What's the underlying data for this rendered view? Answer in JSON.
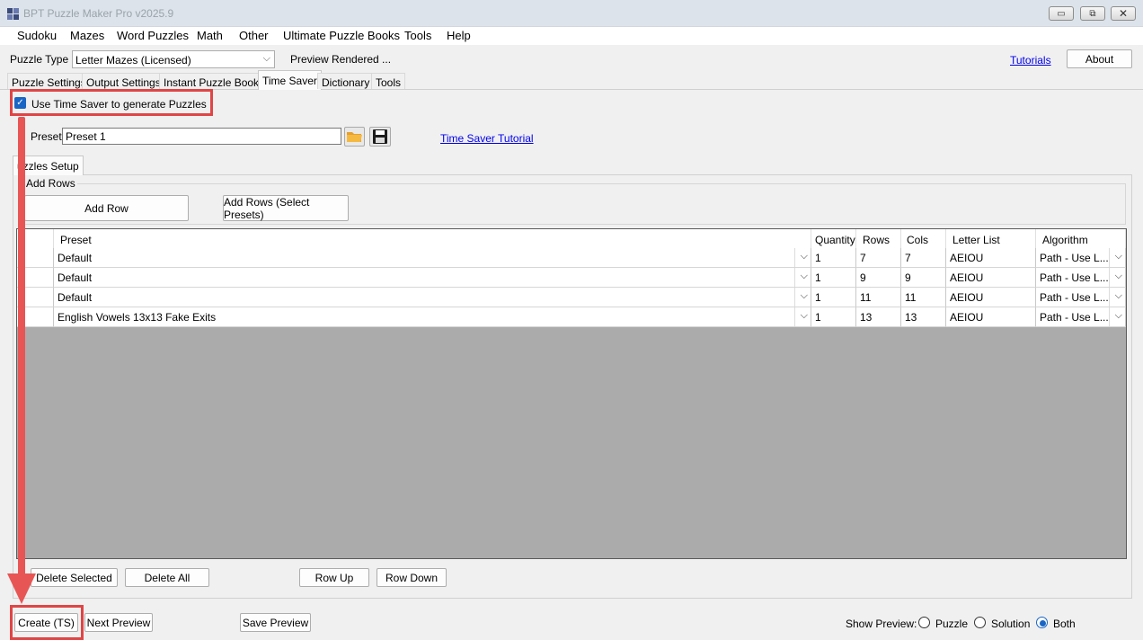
{
  "window": {
    "title": "BPT Puzzle Maker Pro v2025.9",
    "minimize_glyph": "▭",
    "maximize_glyph": "⧉",
    "close_glyph": "✕"
  },
  "menu": [
    "Sudoku",
    "Mazes",
    "Word Puzzles",
    "Math",
    "Other",
    "Ultimate Puzzle Books",
    "Tools",
    "Help"
  ],
  "header": {
    "puzzle_type_label": "Puzzle Type",
    "puzzle_type_value": "Letter Mazes (Licensed)",
    "preview_rendered": "Preview Rendered ...",
    "tutorials": "Tutorials",
    "about": "About"
  },
  "tabs": [
    "Puzzle Settings",
    "Output Settings",
    "Instant Puzzle Books",
    "Time Saver",
    "Dictionary",
    "Tools"
  ],
  "active_tab": "Time Saver",
  "time_saver": {
    "use_checkbox_label": "Use Time Saver to generate Puzzles",
    "use_checked": true,
    "preset_label": "Preset",
    "preset_value": "Preset 1",
    "tutorial_link": "Time Saver Tutorial",
    "setup_tab": "uzzles Setup",
    "add_rows_group": "Add Rows",
    "add_row_button": "Add Row",
    "add_rows_presets_button": "Add Rows (Select Presets)"
  },
  "grid": {
    "columns": [
      "Preset",
      "Quantity",
      "Rows",
      "Cols",
      "Letter List",
      "Algorithm"
    ],
    "rows": [
      {
        "preset": "Default",
        "quantity": "1",
        "rows": "7",
        "cols": "7",
        "letters": "AEIOU",
        "algorithm": "Path - Use L..."
      },
      {
        "preset": "Default",
        "quantity": "1",
        "rows": "9",
        "cols": "9",
        "letters": "AEIOU",
        "algorithm": "Path - Use L..."
      },
      {
        "preset": "Default",
        "quantity": "1",
        "rows": "11",
        "cols": "11",
        "letters": "AEIOU",
        "algorithm": "Path - Use L..."
      },
      {
        "preset": "English Vowels 13x13 Fake Exits",
        "quantity": "1",
        "rows": "13",
        "cols": "13",
        "letters": "AEIOU",
        "algorithm": "Path - Use L..."
      }
    ]
  },
  "buttons": {
    "delete_selected": "Delete Selected",
    "delete_all": "Delete All",
    "row_up": "Row Up",
    "row_down": "Row Down",
    "create_ts": "Create (TS)",
    "next_preview": "Next Preview",
    "save_preview": "Save Preview"
  },
  "show_preview": {
    "label": "Show Preview:",
    "options": [
      "Puzzle",
      "Solution",
      "Both"
    ],
    "selected": "Both"
  },
  "colors": {
    "accent": "#1a66c5",
    "highlight": "#e04545",
    "grid_background": "#ababab"
  }
}
